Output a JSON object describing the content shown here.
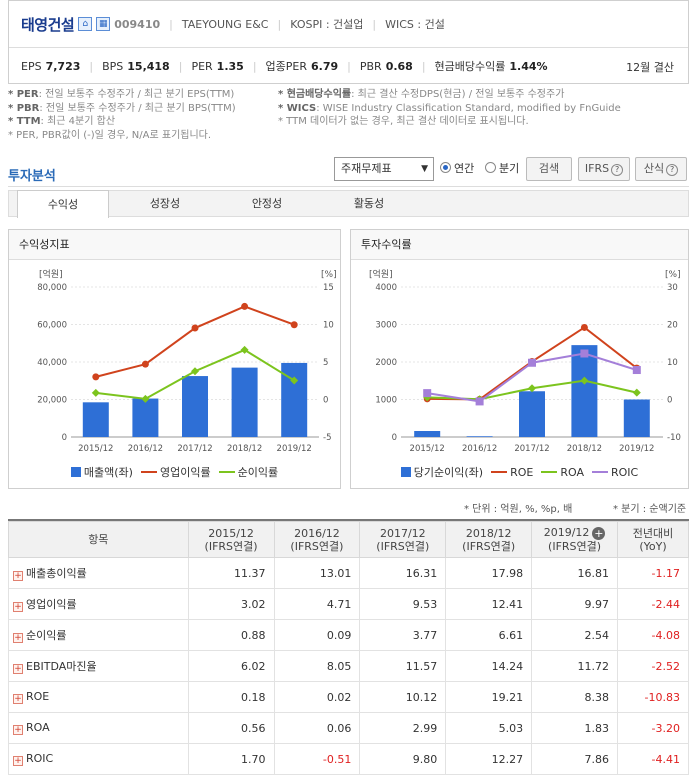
{
  "header": {
    "company_name": "태영건설",
    "icon1": "home-icon",
    "icon2": "building-icon",
    "code": "009410",
    "english_name": "TAEYOUNG E&C",
    "market": "KOSPI : 건설업",
    "wics": "WICS : 건설",
    "metrics": [
      {
        "label": "EPS",
        "value": "7,723"
      },
      {
        "label": "BPS",
        "value": "15,418"
      },
      {
        "label": "PER",
        "value": "1.35"
      },
      {
        "label": "업종PER",
        "value": "6.79"
      },
      {
        "label": "PBR",
        "value": "0.68"
      },
      {
        "label": "현금배당수익률",
        "value": "1.44%"
      }
    ],
    "settlement": "12월 결산"
  },
  "notes": {
    "left": [
      {
        "bold": "* PER",
        "text": ": 전일 보통주 수정주가 / 최근 분기 EPS(TTM)"
      },
      {
        "bold": "* PBR",
        "text": ": 전일 보통주 수정주가 / 최근 분기 BPS(TTM)"
      },
      {
        "bold": "* TTM",
        "text": ": 최근 4분기 합산"
      },
      {
        "bold": "",
        "text": "* PER, PBR값이 (-)일 경우, N/A로 표기됩니다."
      }
    ],
    "right": [
      {
        "bold": "* 현금배당수익률",
        "text": ": 최근 결산 수정DPS(현금) / 전일 보통주 수정주가"
      },
      {
        "bold": "* WICS",
        "text": ": WISE Industry Classification Standard, modified by FnGuide"
      },
      {
        "bold": "",
        "text": "* TTM 데이터가 없는 경우, 최근 결산 데이터로 표시됩니다."
      }
    ]
  },
  "section": {
    "title": "투자분석",
    "select_value": "주재무제표",
    "radio_annual": "연간",
    "radio_quarter": "분기",
    "search_label": "검색",
    "ifrs_label": "IFRS",
    "calc_label": "산식"
  },
  "tabs": [
    "수익성",
    "성장성",
    "안정성",
    "활동성"
  ],
  "chart_data": [
    {
      "type": "bar",
      "title": "수익성지표",
      "categories": [
        "2015/12",
        "2016/12",
        "2017/12",
        "2018/12",
        "2019/12"
      ],
      "left_unit": "[억원]",
      "right_unit": "[%]",
      "left_ticks": [
        "80,000",
        "60,000",
        "40,000",
        "20,000",
        "0"
      ],
      "right_ticks": [
        "15",
        "10",
        "5",
        "0",
        "-5"
      ],
      "ylim_left": [
        0,
        80000
      ],
      "ylim_right": [
        -5,
        15
      ],
      "series": [
        {
          "name": "매출액(좌)",
          "axis": "left",
          "kind": "bar",
          "color": "#2e6fd6",
          "values": [
            18500,
            20500,
            32500,
            37000,
            39500
          ]
        },
        {
          "name": "영업이익률",
          "axis": "right",
          "kind": "line",
          "color": "#d0431d",
          "values": [
            3.02,
            4.71,
            9.53,
            12.41,
            9.97
          ]
        },
        {
          "name": "순이익률",
          "axis": "right",
          "kind": "line",
          "color": "#7cc41e",
          "values": [
            0.88,
            0.09,
            3.77,
            6.61,
            2.54
          ]
        }
      ]
    },
    {
      "type": "bar",
      "title": "투자수익률",
      "categories": [
        "2015/12",
        "2016/12",
        "2017/12",
        "2018/12",
        "2019/12"
      ],
      "left_unit": "[억원]",
      "right_unit": "[%]",
      "left_ticks": [
        "4000",
        "3000",
        "2000",
        "1000",
        "0"
      ],
      "right_ticks": [
        "30",
        "20",
        "10",
        "0",
        "-10"
      ],
      "ylim_left": [
        0,
        4000
      ],
      "ylim_right": [
        -10,
        30
      ],
      "series": [
        {
          "name": "당기순이익(좌)",
          "axis": "left",
          "kind": "bar",
          "color": "#2e6fd6",
          "values": [
            160,
            20,
            1220,
            2450,
            1000
          ]
        },
        {
          "name": "ROE",
          "axis": "right",
          "kind": "line",
          "color": "#d0431d",
          "values": [
            0.18,
            0.02,
            10.12,
            19.21,
            8.38
          ]
        },
        {
          "name": "ROA",
          "axis": "right",
          "kind": "line",
          "color": "#7cc41e",
          "values": [
            0.56,
            0.06,
            2.99,
            5.03,
            1.83
          ]
        },
        {
          "name": "ROIC",
          "axis": "right",
          "kind": "line",
          "color": "#a47fd9",
          "values": [
            1.7,
            -0.51,
            9.8,
            12.27,
            7.86
          ]
        }
      ]
    }
  ],
  "units_left": "* 단위 : 억원, %, %p, 배",
  "units_right": "* 분기 : 순액기준",
  "table": {
    "header_item": "항목",
    "columns": [
      {
        "period": "2015/12",
        "basis": "(IFRS연결)"
      },
      {
        "period": "2016/12",
        "basis": "(IFRS연결)"
      },
      {
        "period": "2017/12",
        "basis": "(IFRS연결)"
      },
      {
        "period": "2018/12",
        "basis": "(IFRS연결)"
      },
      {
        "period": "2019/12",
        "basis": "(IFRS연결)"
      }
    ],
    "yoy_header": "전년대비",
    "yoy_sub": "(YoY)",
    "rows": [
      {
        "name": "매출총이익률",
        "values": [
          "11.37",
          "13.01",
          "16.31",
          "17.98",
          "16.81"
        ],
        "yoy": "-1.17"
      },
      {
        "name": "영업이익률",
        "values": [
          "3.02",
          "4.71",
          "9.53",
          "12.41",
          "9.97"
        ],
        "yoy": "-2.44"
      },
      {
        "name": "순이익률",
        "values": [
          "0.88",
          "0.09",
          "3.77",
          "6.61",
          "2.54"
        ],
        "yoy": "-4.08"
      },
      {
        "name": "EBITDA마진율",
        "values": [
          "6.02",
          "8.05",
          "11.57",
          "14.24",
          "11.72"
        ],
        "yoy": "-2.52"
      },
      {
        "name": "ROE",
        "values": [
          "0.18",
          "0.02",
          "10.12",
          "19.21",
          "8.38"
        ],
        "yoy": "-10.83"
      },
      {
        "name": "ROA",
        "values": [
          "0.56",
          "0.06",
          "2.99",
          "5.03",
          "1.83"
        ],
        "yoy": "-3.20"
      },
      {
        "name": "ROIC",
        "values": [
          "1.70",
          "-0.51",
          "9.80",
          "12.27",
          "7.86"
        ],
        "yoy": "-4.41"
      }
    ]
  }
}
